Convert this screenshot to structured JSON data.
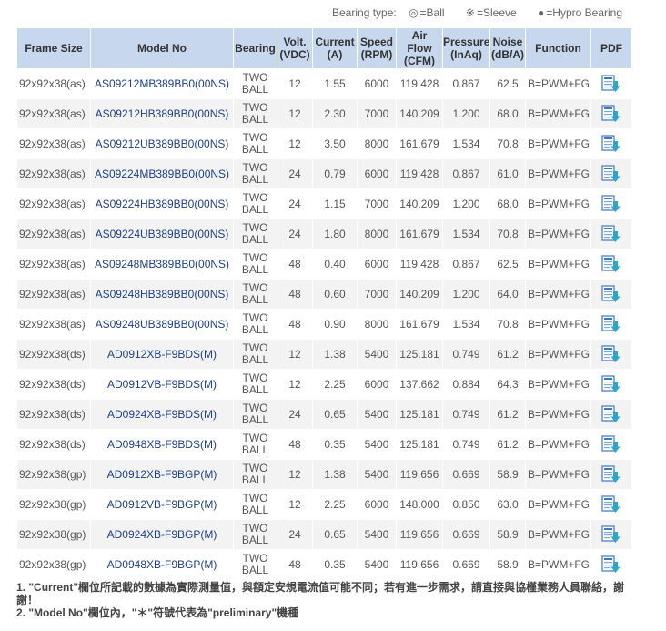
{
  "legend": {
    "label": "Bearing type:",
    "ball_symbol": "◎",
    "ball_text": "=Ball",
    "sleeve_symbol": "※",
    "sleeve_text": "=Sleeve",
    "hypro_symbol": "●",
    "hypro_text": "=Hypro Bearing"
  },
  "table": {
    "headers": [
      [
        "Frame Size"
      ],
      [
        "Model No"
      ],
      [
        "Bearing"
      ],
      [
        "Volt.",
        "(VDC)"
      ],
      [
        "Current",
        "(A)"
      ],
      [
        "Speed",
        "(RPM)"
      ],
      [
        "Air",
        "Flow",
        "(CFM)"
      ],
      [
        "Pressure",
        "(InAq)"
      ],
      [
        "Noise",
        "(dB/A)"
      ],
      [
        "Function"
      ],
      [
        "PDF"
      ]
    ],
    "bearing_line1": "TWO",
    "bearing_line2": "BALL",
    "rows": [
      {
        "frame": "92x92x38(as)",
        "model": "AS09212MB389BB0(00NS)",
        "volt": "12",
        "current": "1.55",
        "speed": "6000",
        "airflow": "119.428",
        "pressure": "0.867",
        "noise": "62.5",
        "function": "B=PWM+FG"
      },
      {
        "frame": "92x92x38(as)",
        "model": "AS09212HB389BB0(00NS)",
        "volt": "12",
        "current": "2.30",
        "speed": "7000",
        "airflow": "140.209",
        "pressure": "1.200",
        "noise": "68.0",
        "function": "B=PWM+FG"
      },
      {
        "frame": "92x92x38(as)",
        "model": "AS09212UB389BB0(00NS)",
        "volt": "12",
        "current": "3.50",
        "speed": "8000",
        "airflow": "161.679",
        "pressure": "1.534",
        "noise": "70.8",
        "function": "B=PWM+FG"
      },
      {
        "frame": "92x92x38(as)",
        "model": "AS09224MB389BB0(00NS)",
        "volt": "24",
        "current": "0.79",
        "speed": "6000",
        "airflow": "119.428",
        "pressure": "0.867",
        "noise": "61.0",
        "function": "B=PWM+FG"
      },
      {
        "frame": "92x92x38(as)",
        "model": "AS09224HB389BB0(00NS)",
        "volt": "24",
        "current": "1.15",
        "speed": "7000",
        "airflow": "140.209",
        "pressure": "1.200",
        "noise": "68.0",
        "function": "B=PWM+FG"
      },
      {
        "frame": "92x92x38(as)",
        "model": "AS09224UB389BB0(00NS)",
        "volt": "24",
        "current": "1.80",
        "speed": "8000",
        "airflow": "161.679",
        "pressure": "1.534",
        "noise": "70.8",
        "function": "B=PWM+FG"
      },
      {
        "frame": "92x92x38(as)",
        "model": "AS09248MB389BB0(00NS)",
        "volt": "48",
        "current": "0.40",
        "speed": "6000",
        "airflow": "119.428",
        "pressure": "0.867",
        "noise": "62.5",
        "function": "B=PWM+FG"
      },
      {
        "frame": "92x92x38(as)",
        "model": "AS09248HB389BB0(00NS)",
        "volt": "48",
        "current": "0.60",
        "speed": "7000",
        "airflow": "140.209",
        "pressure": "1.200",
        "noise": "64.0",
        "function": "B=PWM+FG"
      },
      {
        "frame": "92x92x38(as)",
        "model": "AS09248UB389BB0(00NS)",
        "volt": "48",
        "current": "0.90",
        "speed": "8000",
        "airflow": "161.679",
        "pressure": "1.534",
        "noise": "70.8",
        "function": "B=PWM+FG"
      },
      {
        "frame": "92x92x38(ds)",
        "model": "AD0912XB-F9BDS(M)",
        "volt": "12",
        "current": "1.38",
        "speed": "5400",
        "airflow": "125.181",
        "pressure": "0.749",
        "noise": "61.2",
        "function": "B=PWM+FG"
      },
      {
        "frame": "92x92x38(ds)",
        "model": "AD0912VB-F9BDS(M)",
        "volt": "12",
        "current": "2.25",
        "speed": "6000",
        "airflow": "137.662",
        "pressure": "0.884",
        "noise": "64.3",
        "function": "B=PWM+FG"
      },
      {
        "frame": "92x92x38(ds)",
        "model": "AD0924XB-F9BDS(M)",
        "volt": "24",
        "current": "0.65",
        "speed": "5400",
        "airflow": "125.181",
        "pressure": "0.749",
        "noise": "61.2",
        "function": "B=PWM+FG"
      },
      {
        "frame": "92x92x38(ds)",
        "model": "AD0948XB-F9BDS(M)",
        "volt": "48",
        "current": "0.35",
        "speed": "5400",
        "airflow": "125.181",
        "pressure": "0.749",
        "noise": "61.2",
        "function": "B=PWM+FG"
      },
      {
        "frame": "92x92x38(gp)",
        "model": "AD0912XB-F9BGP(M)",
        "volt": "12",
        "current": "1.38",
        "speed": "5400",
        "airflow": "119.656",
        "pressure": "0.669",
        "noise": "58.9",
        "function": "B=PWM+FG"
      },
      {
        "frame": "92x92x38(gp)",
        "model": "AD0912VB-F9BGP(M)",
        "volt": "12",
        "current": "2.25",
        "speed": "6000",
        "airflow": "148.000",
        "pressure": "0.850",
        "noise": "63.0",
        "function": "B=PWM+FG"
      },
      {
        "frame": "92x92x38(gp)",
        "model": "AD0924XB-F9BGP(M)",
        "volt": "24",
        "current": "0.65",
        "speed": "5400",
        "airflow": "119.656",
        "pressure": "0.669",
        "noise": "58.9",
        "function": "B=PWM+FG"
      },
      {
        "frame": "92x92x38(gp)",
        "model": "AD0948XB-F9BGP(M)",
        "volt": "48",
        "current": "0.35",
        "speed": "5400",
        "airflow": "119.656",
        "pressure": "0.669",
        "noise": "58.9",
        "function": "B=PWM+FG"
      }
    ]
  },
  "notes": [
    "1. \"Current\"欄位所記載的數據為實際測量值，與額定安規電流值可能不同；若有進一步需求，請直接與協槿業務人員聯絡，謝謝！",
    "2. \"Model No\"欄位內，\"＊\"符號代表為\"preliminary\"機種"
  ],
  "colors": {
    "header_bg": "#c7d7ee",
    "row_alt_bg": "#f3f3f3",
    "model_link": "#1c3f8f",
    "pdf_icon_blue": "#3a78c8",
    "pdf_icon_teal": "#2aa6c8"
  },
  "icons": {
    "pdf": "pdf-download-icon"
  }
}
